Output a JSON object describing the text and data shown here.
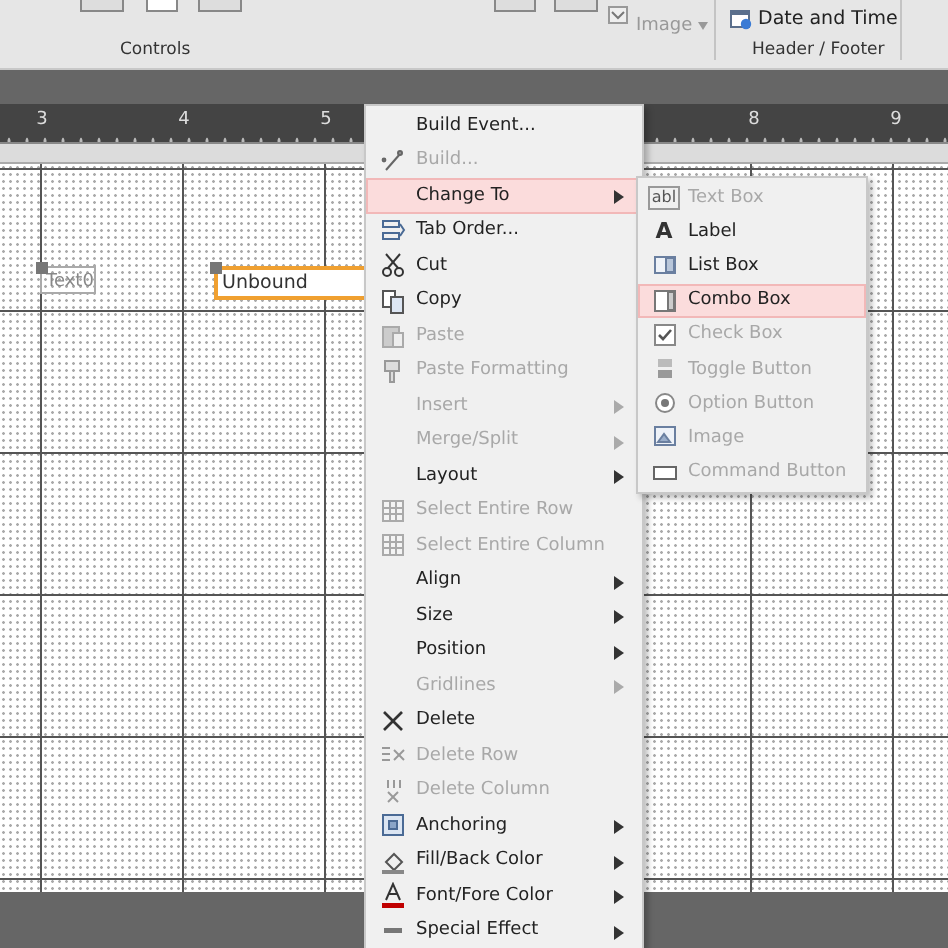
{
  "ribbon": {
    "insert_image": {
      "label": "Image",
      "disabled": true
    },
    "date_time": "Date and Time",
    "groups": [
      "Controls",
      "Header / Footer"
    ]
  },
  "ruler": {
    "left_labels": [
      "3",
      "4",
      "5"
    ],
    "right_labels": [
      "8",
      "9"
    ]
  },
  "form_controls": [
    {
      "kind": "label",
      "text": "Text0",
      "selected": false
    },
    {
      "kind": "textbox",
      "text": "Unbound",
      "selected": true
    }
  ],
  "context_menu": [
    {
      "label": "Build Event...",
      "disabled": false,
      "submenu": false,
      "selected": false
    },
    {
      "label": "Build...",
      "disabled": true,
      "submenu": false,
      "selected": false
    },
    {
      "label": "Change To",
      "disabled": false,
      "submenu": true,
      "selected": true
    },
    {
      "label": "Tab Order...",
      "disabled": false,
      "submenu": false,
      "selected": false
    },
    {
      "label": "Cut",
      "disabled": false,
      "submenu": false,
      "selected": false
    },
    {
      "label": "Copy",
      "disabled": false,
      "submenu": false,
      "selected": false
    },
    {
      "label": "Paste",
      "disabled": true,
      "submenu": false,
      "selected": false
    },
    {
      "label": "Paste Formatting",
      "disabled": true,
      "submenu": false,
      "selected": false
    },
    {
      "label": "Insert",
      "disabled": true,
      "submenu": true,
      "selected": false
    },
    {
      "label": "Merge/Split",
      "disabled": true,
      "submenu": true,
      "selected": false
    },
    {
      "label": "Layout",
      "disabled": false,
      "submenu": true,
      "selected": false
    },
    {
      "label": "Select Entire Row",
      "disabled": true,
      "submenu": false,
      "selected": false
    },
    {
      "label": "Select Entire Column",
      "disabled": true,
      "submenu": false,
      "selected": false
    },
    {
      "label": "Align",
      "disabled": false,
      "submenu": true,
      "selected": false
    },
    {
      "label": "Size",
      "disabled": false,
      "submenu": true,
      "selected": false
    },
    {
      "label": "Position",
      "disabled": false,
      "submenu": true,
      "selected": false
    },
    {
      "label": "Gridlines",
      "disabled": true,
      "submenu": true,
      "selected": false
    },
    {
      "label": "Delete",
      "disabled": false,
      "submenu": false,
      "selected": false
    },
    {
      "label": "Delete Row",
      "disabled": true,
      "submenu": false,
      "selected": false
    },
    {
      "label": "Delete Column",
      "disabled": true,
      "submenu": false,
      "selected": false
    },
    {
      "label": "Anchoring",
      "disabled": false,
      "submenu": true,
      "selected": false
    },
    {
      "label": "Fill/Back Color",
      "disabled": false,
      "submenu": true,
      "selected": false
    },
    {
      "label": "Font/Fore Color",
      "disabled": false,
      "submenu": true,
      "selected": false
    },
    {
      "label": "Special Effect",
      "disabled": false,
      "submenu": true,
      "selected": false
    }
  ],
  "change_to_submenu": [
    {
      "label": "Text Box",
      "icon_text": "abl",
      "disabled": true,
      "selected": false
    },
    {
      "label": "Label",
      "icon_text": "A",
      "disabled": false,
      "selected": false
    },
    {
      "label": "List Box",
      "disabled": false,
      "selected": false
    },
    {
      "label": "Combo Box",
      "disabled": false,
      "selected": true
    },
    {
      "label": "Check Box",
      "disabled": true,
      "selected": false
    },
    {
      "label": "Toggle Button",
      "disabled": true,
      "selected": false
    },
    {
      "label": "Option Button",
      "disabled": true,
      "selected": false
    },
    {
      "label": "Image",
      "disabled": true,
      "selected": false
    },
    {
      "label": "Command Button",
      "disabled": true,
      "selected": false
    }
  ]
}
